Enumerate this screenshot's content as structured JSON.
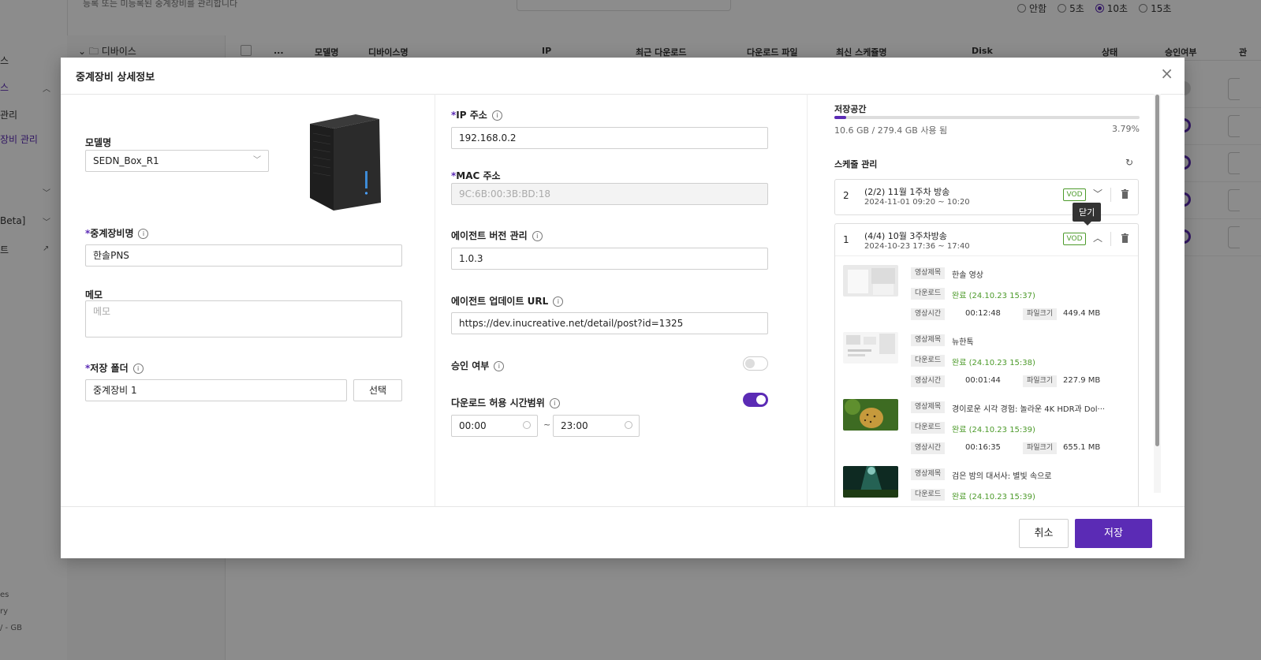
{
  "background": {
    "subtitle": "등록 또는 미등록된 중계장비를 관리합니다",
    "sidebar": {
      "items": [
        {
          "label": "스"
        },
        {
          "label": "스"
        },
        {
          "label": "관리"
        },
        {
          "label": "장비 관리"
        },
        {
          "label": "Beta]"
        },
        {
          "label": "트"
        }
      ],
      "footer": [
        "es",
        "ry",
        "/ - GB"
      ]
    },
    "tree_folder": "디바이스",
    "radio_options": [
      {
        "label": "안함",
        "selected": false
      },
      {
        "label": "5초",
        "selected": false
      },
      {
        "label": "10초",
        "selected": true
      },
      {
        "label": "15초",
        "selected": false
      }
    ],
    "table_headers": [
      "...",
      "모델명",
      "디바이스명",
      "IP",
      "최근 다운로드",
      "다운로드 파일",
      "최신 스케쥴명",
      "Disk",
      "상태",
      "승인여부",
      "관"
    ],
    "rows_approval": [
      false,
      true,
      true,
      true,
      true
    ]
  },
  "modal": {
    "title": "중계장비 상세정보",
    "model": {
      "label": "모델명",
      "value": "SEDN_Box_R1"
    },
    "device_name": {
      "label": "중계장비명",
      "value": "한솔PNS"
    },
    "memo": {
      "label": "메모",
      "placeholder": "메모"
    },
    "storage_folder": {
      "label": "저장 폴더",
      "value": "중계장비 1",
      "button": "선택"
    },
    "ip": {
      "label": "IP 주소",
      "value": "192.168.0.2"
    },
    "mac": {
      "label": "MAC 주소",
      "value": "9C:6B:00:3B:BD:18"
    },
    "agent_version": {
      "label": "에이전트 버전 관리",
      "value": "1.0.3"
    },
    "agent_url": {
      "label": "에이전트 업데이트 URL",
      "value": "https://dev.inucreative.net/detail/post?id=1325"
    },
    "approval": {
      "label": "승인 여부",
      "on": false
    },
    "download_window": {
      "label": "다운로드 허용 시간범위",
      "on": true,
      "start": "00:00",
      "sep": "~",
      "end": "23:00"
    },
    "storage": {
      "label": "저장공간",
      "used_text": "10.6 GB / 279.4 GB 사용 됨",
      "percent_text": "3.79%",
      "percent": 3.79
    },
    "schedule": {
      "label": "스케줄 관리",
      "tooltip": "닫기",
      "items": [
        {
          "num": "2",
          "title": "(2/2) 11월 1주차 방송",
          "date": "2024-11-01 09:20 ~ 10:20",
          "badge": "VOD",
          "expanded": false
        },
        {
          "num": "1",
          "title": "(4/4) 10월 3주차방송",
          "date": "2024-10-23 17:36 ~ 17:40",
          "badge": "VOD",
          "expanded": true
        }
      ],
      "field_labels": {
        "title": "영상제목",
        "download": "다운로드",
        "duration": "영상시간",
        "size": "파일크기"
      },
      "videos": [
        {
          "title": "한솔 영상",
          "download": "완료 (24.10.23 15:37)",
          "duration": "00:12:48",
          "size": "449.4 MB",
          "thumb": "room"
        },
        {
          "title": "뉴한톡",
          "download": "완료 (24.10.23 15:38)",
          "duration": "00:01:44",
          "size": "227.9 MB",
          "thumb": "ui"
        },
        {
          "title": "경이로운 시각 경험: 놀라운 4K HDR과 Dol···",
          "download": "완료 (24.10.23 15:39)",
          "duration": "00:16:35",
          "size": "655.1 MB",
          "thumb": "leopard"
        },
        {
          "title": "검은 밤의 대서사: 별빛 속으로",
          "download": "완료 (24.10.23 15:39)",
          "thumb": "forest"
        }
      ]
    },
    "buttons": {
      "cancel": "취소",
      "save": "저장"
    }
  },
  "colors": {
    "accent": "#5b2bb5",
    "success": "#4c9a2a"
  }
}
